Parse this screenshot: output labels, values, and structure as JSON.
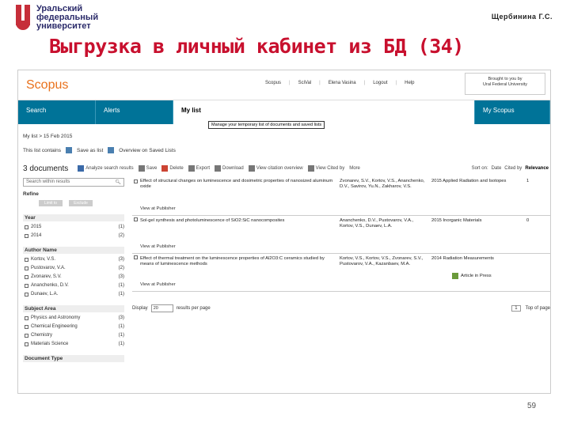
{
  "slide": {
    "logo_lines": [
      "Уральский",
      "федеральный",
      "университет"
    ],
    "author": "Щербинина Г.С.",
    "title": "Выгрузка в личный кабинет из БД (34)",
    "page_number": "59"
  },
  "scopus": {
    "brand": "Scopus",
    "topnav": [
      "Scopus",
      "SciVal",
      "Elena Vasina",
      "Logout",
      "Help"
    ],
    "institution_lines": [
      "Brought to you by",
      "Ural Federal University"
    ],
    "tabs": [
      "Search",
      "Alerts",
      "My list",
      "My Scopus"
    ],
    "tooltip": "Manage your temporary list of documents and saved lists",
    "dated": "My list > 15 Feb 2015",
    "list_info": {
      "label": "This list contains",
      "save": "Save as list",
      "overview": "Overview on Saved Lists"
    },
    "toolbar": {
      "count": "3 documents",
      "analyze": "Analyze search results",
      "actions": [
        "Save",
        "Delete",
        "Export",
        "Download",
        "View citation overview",
        "View Cited by",
        "More"
      ],
      "sort_label": "Sort on:",
      "sort_options": [
        "Date",
        "Cited by",
        "Relevance"
      ]
    },
    "sidebar": {
      "search_placeholder": "Search within results",
      "refine": "Refine",
      "limit": "Limit to",
      "exclude": "Exclude",
      "year": {
        "head": "Year",
        "items": [
          {
            "label": "2015",
            "count": "(1)"
          },
          {
            "label": "2014",
            "count": "(2)"
          }
        ]
      },
      "author": {
        "head": "Author Name",
        "items": [
          {
            "label": "Kortov, V.S.",
            "count": "(3)"
          },
          {
            "label": "Pustovarov, V.A.",
            "count": "(2)"
          },
          {
            "label": "Zvonarev, S.V.",
            "count": "(3)"
          },
          {
            "label": "Ananchenko, D.V.",
            "count": "(1)"
          },
          {
            "label": "Dunaev, L.A.",
            "count": "(1)"
          }
        ]
      },
      "subject": {
        "head": "Subject Area",
        "items": [
          {
            "label": "Physics and Astronomy",
            "count": "(3)"
          },
          {
            "label": "Chemical Engineering",
            "count": "(1)"
          },
          {
            "label": "Chemistry",
            "count": "(1)"
          },
          {
            "label": "Materials Science",
            "count": "(1)"
          }
        ]
      },
      "doctype": {
        "head": "Document Type"
      }
    },
    "results": [
      {
        "title": "Effect of structural changes on luminescence and dosimetric properties of nanosized aluminum oxide",
        "authors": "Zvonarev, S.V., Kortov, V.S., Ananchenko, D.V., Savirov, Yu.N., Zakharov, V.S.",
        "year_source": "2015 Applied Radiation and Isotopes",
        "cited": "1",
        "view": "View at Publisher"
      },
      {
        "title": "Sol-gel synthesis and photoluminescence of SiO2:SiC nanocomposites",
        "authors": "Ananchenko, D.V., Pustovarov, V.A., Kortov, V.S., Dunaev, L.A.",
        "year_source": "2015 Inorganic Materials",
        "cited": "0",
        "view": "View at Publisher"
      },
      {
        "title": "Effect of thermal treatment on the luminescence properties of Al2O3:C ceramics studied by means of luminescence methods",
        "authors": "Kortov, V.S., Kortov, V.S., Zvonarev, S.V., Pustovarov, V.A., Kazanbaev, M.A.",
        "year_source": "2014 Radiation Measurements",
        "cited": "",
        "view": "View at Publisher",
        "badge": "Article in Press"
      }
    ],
    "display": {
      "label": "Display",
      "value": "20",
      "suffix": "results per page",
      "page": "1",
      "top": "Top of page"
    }
  }
}
